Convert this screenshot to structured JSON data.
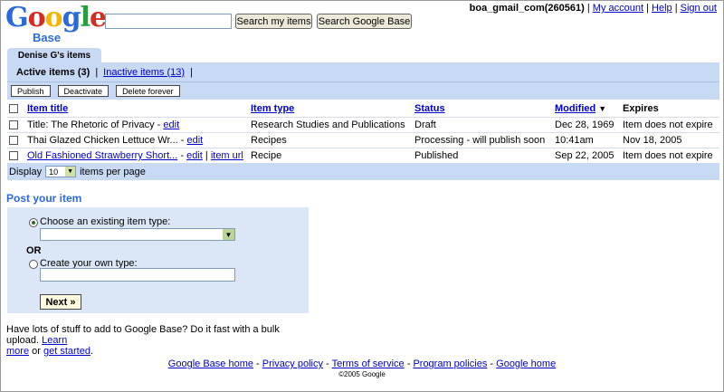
{
  "header": {
    "logo_text": "Google",
    "logo_sub": "Base",
    "search_my_items_label": "Search my items",
    "search_base_label": "Search Google Base",
    "account": "boa_gmail_com(260561)",
    "links": [
      "My account",
      "Help",
      "Sign out"
    ]
  },
  "tab": {
    "label": "Denise G's items"
  },
  "filters": {
    "active": "Active items (3)",
    "inactive": "Inactive items (13)"
  },
  "actions": [
    "Publish",
    "Deactivate",
    "Delete forever"
  ],
  "table": {
    "headers": {
      "title": "Item title",
      "type": "Item type",
      "status": "Status",
      "modified": "Modified",
      "sort_indicator": "▼",
      "expires": "Expires"
    },
    "rows": [
      {
        "title": "Title: The Rhetoric of Privacy",
        "title_link": false,
        "edit": "edit",
        "url": "",
        "type": "Research Studies and Publications",
        "status": "Draft",
        "modified": "Dec 28, 1969",
        "expires": "Item does not expire"
      },
      {
        "title": "Thai Glazed Chicken Lettuce Wr...",
        "title_link": false,
        "edit": "edit",
        "url": "",
        "type": "Recipes",
        "status": "Processing - will publish soon",
        "modified": "10:41am",
        "expires": "Nov 18, 2005"
      },
      {
        "title": "Old Fashioned Strawberry Short...",
        "title_link": true,
        "edit": "edit",
        "url": "item url",
        "type": "Recipe",
        "status": "Published",
        "modified": "Sep 22, 2005",
        "expires": "Item does not expire"
      }
    ],
    "sep": " - ",
    "url_sep": "|"
  },
  "display": {
    "label": "Display",
    "value": "10",
    "suffix": "items per page"
  },
  "post": {
    "title": "Post your item",
    "choose_label": "Choose an existing item type:",
    "or": "OR",
    "create_label": "Create your own type:",
    "next": "Next »"
  },
  "bulk": {
    "text1": "Have lots of stuff to add to Google Base? Do it fast with a bulk upload.",
    "learn": "Learn",
    "more": "more",
    "or": "or",
    "get_started": "get started",
    "period": "."
  },
  "footer": {
    "links": [
      "Google Base home",
      "Privacy policy",
      "Terms of service",
      "Program policies",
      "Google home"
    ],
    "copyright": "©2005 Google"
  }
}
